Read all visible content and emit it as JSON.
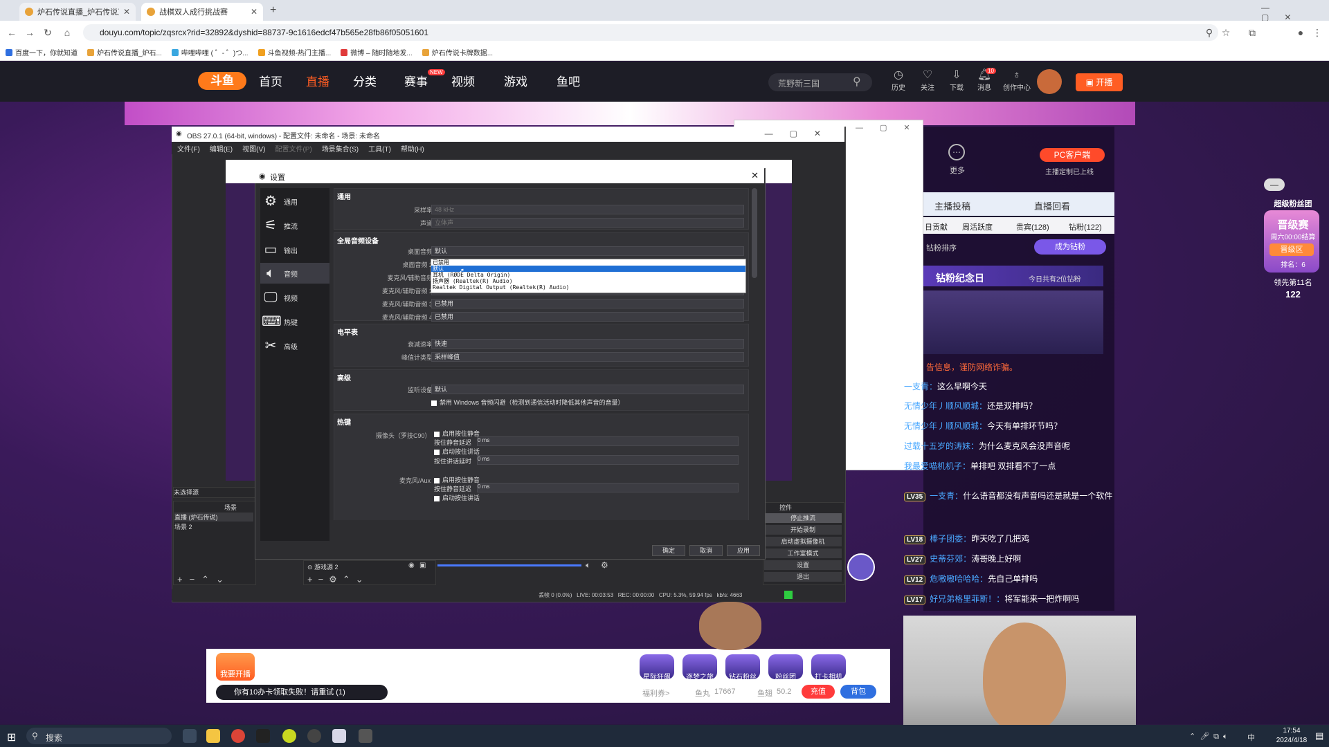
{
  "browser": {
    "tabs": [
      {
        "title": "炉石传说直播_炉石传说直播视...",
        "active": false
      },
      {
        "title": "战棋双人成行挑战赛",
        "active": true
      }
    ],
    "url": "douyu.com/topic/zqsrcx?rid=32892&dyshid=88737-9c1616edcf47b565e28fb86f05051601",
    "bookmarks": [
      "百度一下，你就知道",
      "炉石传说直播_炉石...",
      "哔哩哔哩 ( ゜- ゜)つ...",
      "斗鱼视频-热门主播...",
      "微博 – 随时随地发...",
      "炉石传说卡牌数据..."
    ]
  },
  "site": {
    "logo": "斗鱼",
    "nav": [
      "首页",
      "直播",
      "分类",
      "赛事",
      "视频",
      "游戏",
      "鱼吧"
    ],
    "nav_badge": "NEW",
    "search_placeholder": "荒野新三国",
    "header_icons": [
      "历史",
      "关注",
      "下载",
      "消息",
      "创作中心"
    ],
    "msg_count": "10",
    "live_button": "开播"
  },
  "obs": {
    "title": "OBS 27.0.1 (64-bit, windows) - 配置文件: 未命名 - 场景: 未命名",
    "menu": [
      "文件(F)",
      "编辑(E)",
      "视图(V)",
      "配置文件(P)",
      "场景集合(S)",
      "工具(T)",
      "帮助(H)"
    ],
    "scenes_header": "场景",
    "scenes": [
      "直播 (炉石传说)",
      "场景 2"
    ],
    "source_label": "游戏源 2",
    "unsaved_label": "未选择源",
    "controls_header": "控件",
    "controls": [
      "停止推流",
      "开始录制",
      "启动虚拟摄像机",
      "工作室模式",
      "设置",
      "退出"
    ],
    "status": "丢帧 0 (0.0%)   LIVE: 00:03:53   REC: 00:00:00   CPU: 5.3%, 59.94 fps   kb/s: 4663"
  },
  "settings": {
    "title": "设置",
    "sidebar": [
      "通用",
      "推流",
      "输出",
      "音频",
      "视频",
      "热键",
      "高级"
    ],
    "sections": {
      "general": {
        "title": "通用",
        "sample_rate_label": "采样率",
        "sample_rate": "48 kHz",
        "channels_label": "声道",
        "channels": "立体声"
      },
      "global_audio": {
        "title": "全局音频设备",
        "rows": [
          {
            "label": "桌面音频",
            "value": "默认"
          },
          {
            "label": "桌面音频 2",
            "value": ""
          },
          {
            "label": "麦克风/辅助音频",
            "value": ""
          },
          {
            "label": "麦克风/辅助音频 2",
            "value": "已禁用"
          },
          {
            "label": "麦克风/辅助音频 3",
            "value": "已禁用"
          },
          {
            "label": "麦克风/辅助音频 4",
            "value": "已禁用"
          }
        ]
      },
      "meters": {
        "title": "电平表",
        "decay_label": "衰减速率",
        "decay": "快速",
        "peak_label": "峰值计类型",
        "peak": "采样峰值"
      },
      "advanced": {
        "title": "高级",
        "monitor_label": "监听设备",
        "monitor": "默认",
        "ducking": "禁用 Windows 音频闪避（检测到通信活动时降低其他声音的音量）"
      },
      "hotkeys": {
        "title": "热键",
        "camera_label": "摄像头（罗技C90）",
        "mic_label": "麦克风/Aux",
        "enable_ptm": "启用按住静音",
        "ptm_delay": "按住静音延迟",
        "enable_ptt": "启动按住讲话",
        "ptt_delay": "按住讲话延时",
        "zero_ms": "0 ms"
      }
    },
    "dropdown_options": [
      "已禁用",
      "默认",
      "耳机 (RØDE Delta Origin)",
      "扬声器 (Realtek(R) Audio)",
      "Realtek Digital Output (Realtek(R) Audio)"
    ],
    "buttons": {
      "ok": "确定",
      "cancel": "取消",
      "apply": "应用"
    }
  },
  "right_panel": {
    "more": "更多",
    "pc_client": "PC客户端",
    "pc_desc": "主播定制已上线",
    "tabs": [
      "主播投稿",
      "直播回看"
    ],
    "rank_tabs": [
      "日贡献",
      "周活跃度",
      "贵宾(128)",
      "钻粉(122)"
    ],
    "rank_note": "钻粉排序",
    "become_diamond": "成为钻粉",
    "diamond_day": "钻粉纪念日",
    "diamond_today": "今日共有2位钻粉",
    "super_fan": "超级粉丝团",
    "promote": "晋级赛",
    "promote_time": "周六00:00结算",
    "promote_zone": "晋级区",
    "rank": "排名：6",
    "lead": "领先第11名",
    "lead_num": "122",
    "notice": "告信息，谨防网络诈骗。",
    "chat": [
      {
        "lv": "",
        "name": "一支青：",
        "msg": "这么早啊今天"
      },
      {
        "lv": "",
        "name": "无情少年丿顺风顺城：",
        "msg": "还是双排吗？"
      },
      {
        "lv": "",
        "name": "无情少年丿顺风顺城：",
        "msg": "今天有单排环节吗？"
      },
      {
        "lv": "",
        "name": "过载十五岁的涛妹：",
        "msg": "为什么麦克风会没声音呢"
      },
      {
        "lv": "",
        "name": "我最爱喵机机子：",
        "msg": "单排吧 双排看不了一点"
      },
      {
        "lv": "LV35",
        "name": "一支青：",
        "msg": "什么语音都没有声音吗还是就是一个软件"
      },
      {
        "lv": "LV18",
        "name": "棒子团委：",
        "msg": "昨天吃了几把鸡"
      },
      {
        "lv": "LV27",
        "name": "史蒂芬郊：",
        "msg": "涛哥晚上好啊"
      },
      {
        "lv": "LV12",
        "name": "危嗷嗷哈哈哈：",
        "msg": "先自己单排吗"
      },
      {
        "lv": "LV17",
        "name": "好兄弟格里菲斯！：",
        "msg": "将军能来一把炸啊吗"
      }
    ]
  },
  "bottom": {
    "start_live": "我要开播",
    "fail_notice": "你有10办卡领取失败！请重试 (1)",
    "gifts": [
      "星际狂飙",
      "逐梦之旅",
      "钻石粉丝",
      "粉丝团",
      "打卡相机"
    ],
    "welfare": "福利券>",
    "fish_ball": "鱼丸",
    "fish_ball_val": "17667",
    "fish_chip": "鱼翅",
    "fish_chip_val": "50.2",
    "recharge": "充值",
    "backpack": "背包"
  },
  "taskbar": {
    "search": "搜索",
    "time": "17:54",
    "date": "2024/4/18",
    "ime": "中"
  },
  "colors": {
    "accent": "#ff5d23",
    "selected": "#1f6fd4",
    "obs_bg": "#2b2b2e"
  }
}
